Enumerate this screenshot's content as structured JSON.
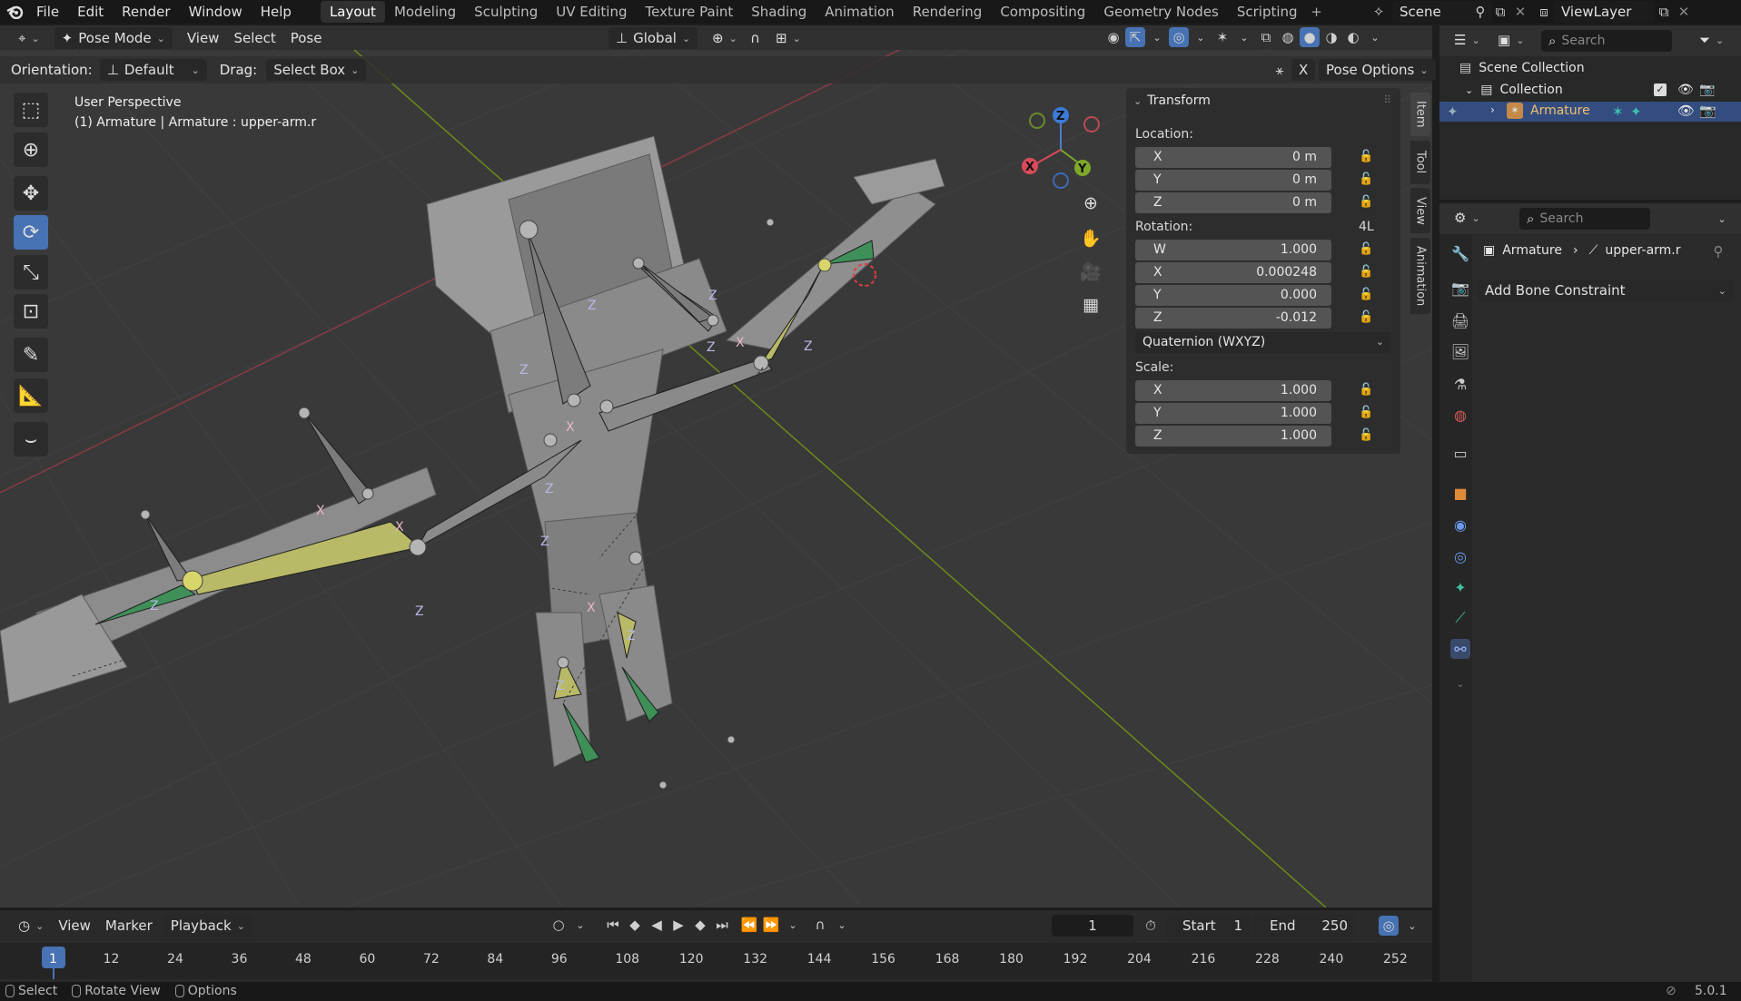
{
  "menu": {
    "items": [
      "File",
      "Edit",
      "Render",
      "Window",
      "Help"
    ]
  },
  "workspaces": [
    "Layout",
    "Modeling",
    "Sculpting",
    "UV Editing",
    "Texture Paint",
    "Shading",
    "Animation",
    "Rendering",
    "Compositing",
    "Geometry Nodes",
    "Scripting"
  ],
  "active_workspace": "Layout",
  "scene": {
    "name": "Scene"
  },
  "view_layer": {
    "name": "ViewLayer"
  },
  "viewport_header": {
    "mode": "Pose Mode",
    "menus": [
      "View",
      "Select",
      "Pose"
    ],
    "transform_orientation": "Global"
  },
  "tool_header": {
    "orientation_label": "Orientation:",
    "orientation_value": "Default",
    "drag_label": "Drag:",
    "drag_value": "Select Box",
    "x_mirror": "X",
    "pose_options": "Pose Options"
  },
  "overlay_text": {
    "perspective": "User Perspective",
    "context": "(1) Armature | Armature : upper-arm.r"
  },
  "gizmo_axes": {
    "z": "Z",
    "y": "Y",
    "x": "X"
  },
  "bone_axis_labels": [
    {
      "t": "Z"
    },
    {
      "t": "Z"
    },
    {
      "t": "X"
    },
    {
      "t": "Z"
    },
    {
      "t": "X"
    },
    {
      "t": "Z"
    },
    {
      "t": "Z"
    },
    {
      "t": "Z"
    },
    {
      "t": "X"
    },
    {
      "t": "X"
    },
    {
      "t": "Z"
    },
    {
      "t": "X"
    },
    {
      "t": "Z"
    },
    {
      "t": "Z"
    },
    {
      "t": "Z"
    },
    {
      "t": "Z"
    }
  ],
  "transform": {
    "title": "Transform",
    "location_label": "Location:",
    "location": [
      {
        "axis": "X",
        "value": "0 m"
      },
      {
        "axis": "Y",
        "value": "0 m"
      },
      {
        "axis": "Z",
        "value": "0 m"
      }
    ],
    "rotation_label": "Rotation:",
    "rotation_lock_label": "4L",
    "rotation": [
      {
        "axis": "W",
        "value": "1.000"
      },
      {
        "axis": "X",
        "value": "0.000248"
      },
      {
        "axis": "Y",
        "value": "0.000"
      },
      {
        "axis": "Z",
        "value": "-0.012"
      }
    ],
    "rotation_mode": "Quaternion (WXYZ)",
    "scale_label": "Scale:",
    "scale": [
      {
        "axis": "X",
        "value": "1.000"
      },
      {
        "axis": "Y",
        "value": "1.000"
      },
      {
        "axis": "Z",
        "value": "1.000"
      }
    ]
  },
  "sidebar_tabs": [
    "Item",
    "Tool",
    "View",
    "Animation"
  ],
  "timeline": {
    "menus": [
      "View",
      "Marker",
      "Playback"
    ],
    "current_frame": "1",
    "start_label": "Start",
    "start": "1",
    "end_label": "End",
    "end": "250",
    "ruler": [
      "1",
      "12",
      "24",
      "36",
      "48",
      "60",
      "72",
      "84",
      "96",
      "108",
      "120",
      "132",
      "144",
      "156",
      "168",
      "180",
      "192",
      "204",
      "216",
      "228",
      "240",
      "252"
    ]
  },
  "outliner": {
    "search_placeholder": "Search",
    "scene_collection": "Scene Collection",
    "collection": "Collection",
    "armature": "Armature"
  },
  "properties": {
    "search_placeholder": "Search",
    "breadcrumb_object": "Armature",
    "breadcrumb_bone": "upper-arm.r",
    "add_constraint": "Add Bone Constraint"
  },
  "status": {
    "select": "Select",
    "rotate": "Rotate View",
    "options": "Options",
    "version": "5.0.1"
  }
}
